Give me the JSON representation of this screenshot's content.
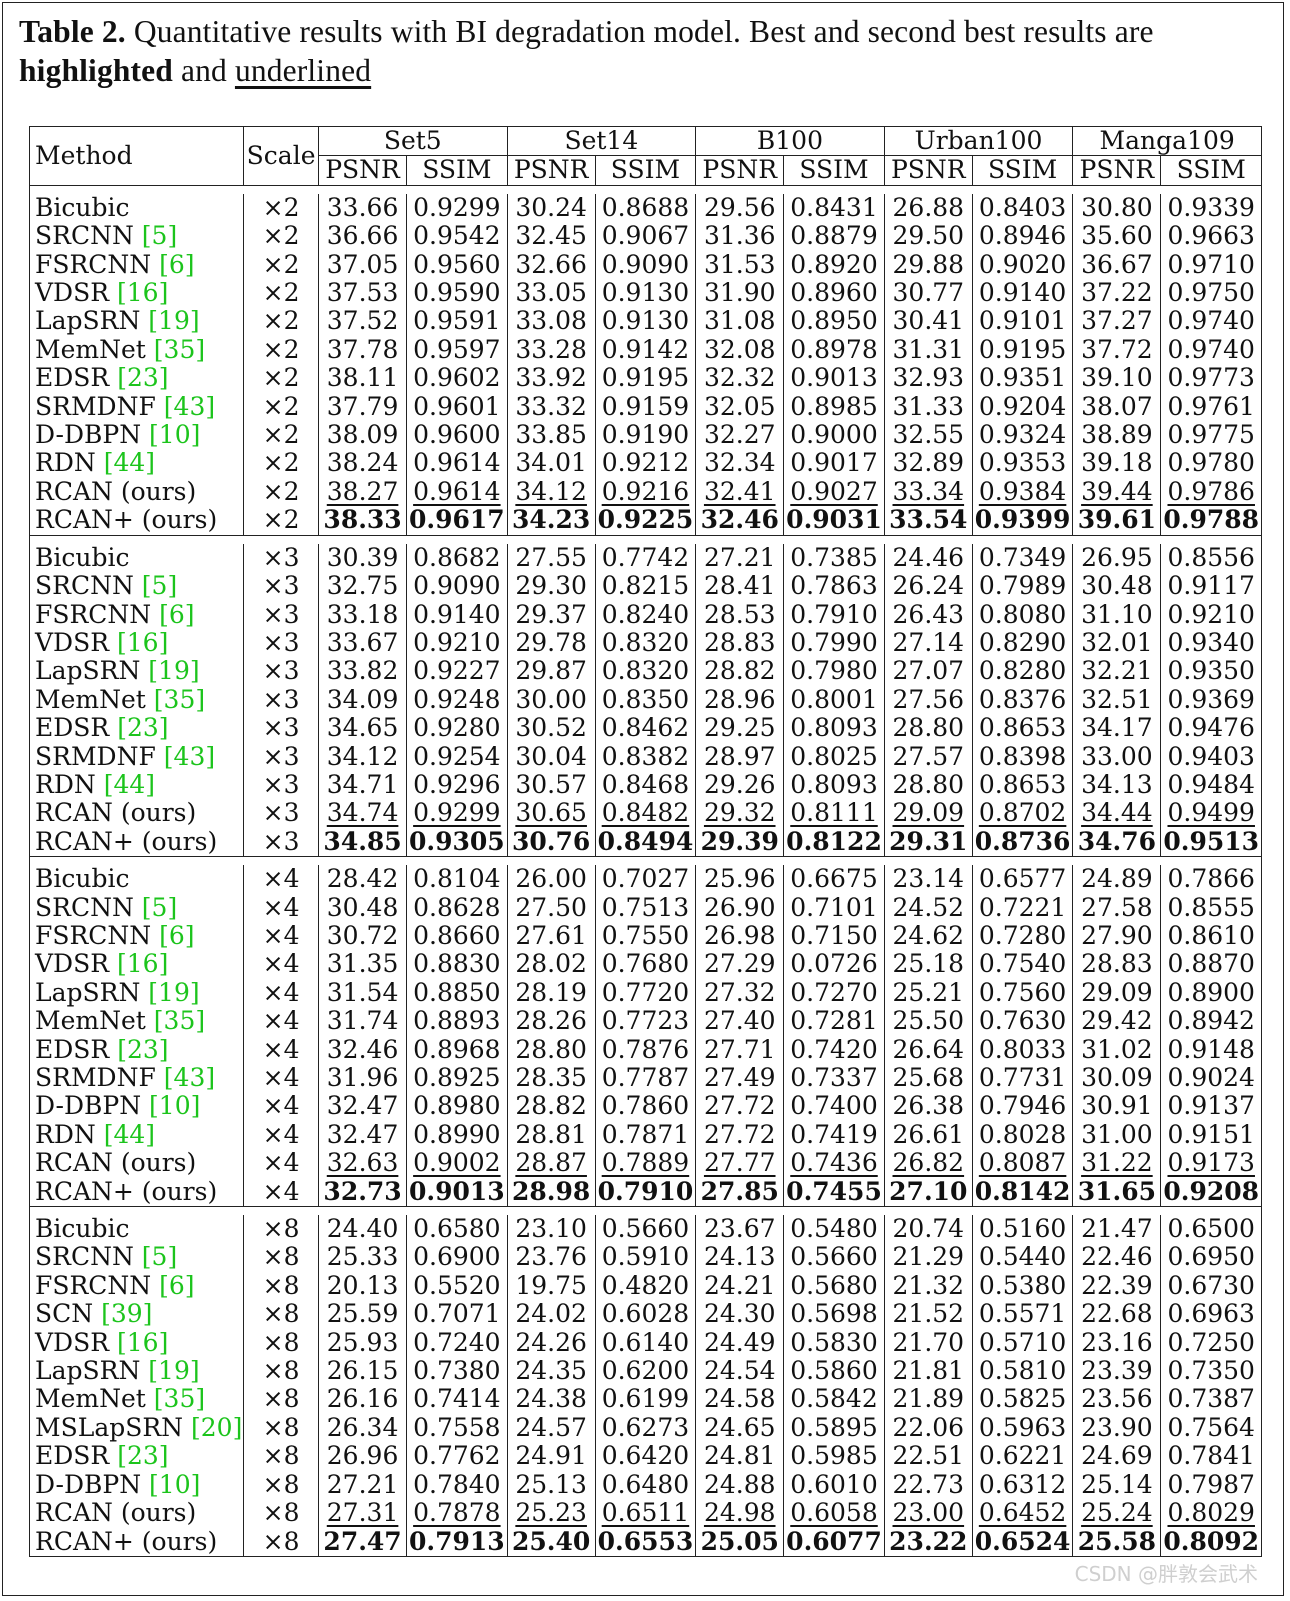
{
  "caption": {
    "label": "Table 2.",
    "text1": " Quantitative results with BI degradation model. Best and second best results are ",
    "highlighted": "highlighted",
    "text2": " and ",
    "underlined": "underlined"
  },
  "header": {
    "method": "Method",
    "scale": "Scale",
    "datasets": [
      "Set5",
      "Set14",
      "B100",
      "Urban100",
      "Manga109"
    ],
    "metrics": [
      "PSNR",
      "SSIM"
    ]
  },
  "groups": [
    {
      "rows": [
        {
          "method": "Bicubic",
          "cite": "",
          "scale": "×2",
          "values": [
            "33.66",
            "0.9299",
            "30.24",
            "0.8688",
            "29.56",
            "0.8431",
            "26.88",
            "0.8403",
            "30.80",
            "0.9339"
          ],
          "style": ""
        },
        {
          "method": "SRCNN",
          "cite": "[5]",
          "scale": "×2",
          "values": [
            "36.66",
            "0.9542",
            "32.45",
            "0.9067",
            "31.36",
            "0.8879",
            "29.50",
            "0.8946",
            "35.60",
            "0.9663"
          ],
          "style": ""
        },
        {
          "method": "FSRCNN",
          "cite": "[6]",
          "scale": "×2",
          "values": [
            "37.05",
            "0.9560",
            "32.66",
            "0.9090",
            "31.53",
            "0.8920",
            "29.88",
            "0.9020",
            "36.67",
            "0.9710"
          ],
          "style": ""
        },
        {
          "method": "VDSR",
          "cite": "[16]",
          "scale": "×2",
          "values": [
            "37.53",
            "0.9590",
            "33.05",
            "0.9130",
            "31.90",
            "0.8960",
            "30.77",
            "0.9140",
            "37.22",
            "0.9750"
          ],
          "style": ""
        },
        {
          "method": "LapSRN",
          "cite": "[19]",
          "scale": "×2",
          "values": [
            "37.52",
            "0.9591",
            "33.08",
            "0.9130",
            "31.08",
            "0.8950",
            "30.41",
            "0.9101",
            "37.27",
            "0.9740"
          ],
          "style": ""
        },
        {
          "method": "MemNet",
          "cite": "[35]",
          "scale": "×2",
          "values": [
            "37.78",
            "0.9597",
            "33.28",
            "0.9142",
            "32.08",
            "0.8978",
            "31.31",
            "0.9195",
            "37.72",
            "0.9740"
          ],
          "style": ""
        },
        {
          "method": "EDSR",
          "cite": "[23]",
          "scale": "×2",
          "values": [
            "38.11",
            "0.9602",
            "33.92",
            "0.9195",
            "32.32",
            "0.9013",
            "32.93",
            "0.9351",
            "39.10",
            "0.9773"
          ],
          "style": ""
        },
        {
          "method": "SRMDNF",
          "cite": "[43]",
          "scale": "×2",
          "values": [
            "37.79",
            "0.9601",
            "33.32",
            "0.9159",
            "32.05",
            "0.8985",
            "31.33",
            "0.9204",
            "38.07",
            "0.9761"
          ],
          "style": ""
        },
        {
          "method": "D-DBPN",
          "cite": "[10]",
          "scale": "×2",
          "values": [
            "38.09",
            "0.9600",
            "33.85",
            "0.9190",
            "32.27",
            "0.9000",
            "32.55",
            "0.9324",
            "38.89",
            "0.9775"
          ],
          "style": ""
        },
        {
          "method": "RDN",
          "cite": "[44]",
          "scale": "×2",
          "values": [
            "38.24",
            "0.9614",
            "34.01",
            "0.9212",
            "32.34",
            "0.9017",
            "32.89",
            "0.9353",
            "39.18",
            "0.9780"
          ],
          "style": ""
        },
        {
          "method": "RCAN (ours)",
          "cite": "",
          "scale": "×2",
          "values": [
            "38.27",
            "0.9614",
            "34.12",
            "0.9216",
            "32.41",
            "0.9027",
            "33.34",
            "0.9384",
            "39.44",
            "0.9786"
          ],
          "style": "u"
        },
        {
          "method": "RCAN+ (ours)",
          "cite": "",
          "scale": "×2",
          "values": [
            "38.33",
            "0.9617",
            "34.23",
            "0.9225",
            "32.46",
            "0.9031",
            "33.54",
            "0.9399",
            "39.61",
            "0.9788"
          ],
          "style": "b"
        }
      ]
    },
    {
      "rows": [
        {
          "method": "Bicubic",
          "cite": "",
          "scale": "×3",
          "values": [
            "30.39",
            "0.8682",
            "27.55",
            "0.7742",
            "27.21",
            "0.7385",
            "24.46",
            "0.7349",
            "26.95",
            "0.8556"
          ],
          "style": ""
        },
        {
          "method": "SRCNN",
          "cite": "[5]",
          "scale": "×3",
          "values": [
            "32.75",
            "0.9090",
            "29.30",
            "0.8215",
            "28.41",
            "0.7863",
            "26.24",
            "0.7989",
            "30.48",
            "0.9117"
          ],
          "style": ""
        },
        {
          "method": "FSRCNN",
          "cite": "[6]",
          "scale": "×3",
          "values": [
            "33.18",
            "0.9140",
            "29.37",
            "0.8240",
            "28.53",
            "0.7910",
            "26.43",
            "0.8080",
            "31.10",
            "0.9210"
          ],
          "style": ""
        },
        {
          "method": "VDSR",
          "cite": "[16]",
          "scale": "×3",
          "values": [
            "33.67",
            "0.9210",
            "29.78",
            "0.8320",
            "28.83",
            "0.7990",
            "27.14",
            "0.8290",
            "32.01",
            "0.9340"
          ],
          "style": ""
        },
        {
          "method": "LapSRN",
          "cite": "[19]",
          "scale": "×3",
          "values": [
            "33.82",
            "0.9227",
            "29.87",
            "0.8320",
            "28.82",
            "0.7980",
            "27.07",
            "0.8280",
            "32.21",
            "0.9350"
          ],
          "style": ""
        },
        {
          "method": "MemNet",
          "cite": "[35]",
          "scale": "×3",
          "values": [
            "34.09",
            "0.9248",
            "30.00",
            "0.8350",
            "28.96",
            "0.8001",
            "27.56",
            "0.8376",
            "32.51",
            "0.9369"
          ],
          "style": ""
        },
        {
          "method": "EDSR",
          "cite": "[23]",
          "scale": "×3",
          "values": [
            "34.65",
            "0.9280",
            "30.52",
            "0.8462",
            "29.25",
            "0.8093",
            "28.80",
            "0.8653",
            "34.17",
            "0.9476"
          ],
          "style": ""
        },
        {
          "method": "SRMDNF",
          "cite": "[43]",
          "scale": "×3",
          "values": [
            "34.12",
            "0.9254",
            "30.04",
            "0.8382",
            "28.97",
            "0.8025",
            "27.57",
            "0.8398",
            "33.00",
            "0.9403"
          ],
          "style": ""
        },
        {
          "method": "RDN",
          "cite": "[44]",
          "scale": "×3",
          "values": [
            "34.71",
            "0.9296",
            "30.57",
            "0.8468",
            "29.26",
            "0.8093",
            "28.80",
            "0.8653",
            "34.13",
            "0.9484"
          ],
          "style": ""
        },
        {
          "method": "RCAN (ours)",
          "cite": "",
          "scale": "×3",
          "values": [
            "34.74",
            "0.9299",
            "30.65",
            "0.8482",
            "29.32",
            "0.8111",
            "29.09",
            "0.8702",
            "34.44",
            "0.9499"
          ],
          "style": "u"
        },
        {
          "method": "RCAN+ (ours)",
          "cite": "",
          "scale": "×3",
          "values": [
            "34.85",
            "0.9305",
            "30.76",
            "0.8494",
            "29.39",
            "0.8122",
            "29.31",
            "0.8736",
            "34.76",
            "0.9513"
          ],
          "style": "b"
        }
      ]
    },
    {
      "rows": [
        {
          "method": "Bicubic",
          "cite": "",
          "scale": "×4",
          "values": [
            "28.42",
            "0.8104",
            "26.00",
            "0.7027",
            "25.96",
            "0.6675",
            "23.14",
            "0.6577",
            "24.89",
            "0.7866"
          ],
          "style": ""
        },
        {
          "method": "SRCNN",
          "cite": "[5]",
          "scale": "×4",
          "values": [
            "30.48",
            "0.8628",
            "27.50",
            "0.7513",
            "26.90",
            "0.7101",
            "24.52",
            "0.7221",
            "27.58",
            "0.8555"
          ],
          "style": ""
        },
        {
          "method": "FSRCNN",
          "cite": "[6]",
          "scale": "×4",
          "values": [
            "30.72",
            "0.8660",
            "27.61",
            "0.7550",
            "26.98",
            "0.7150",
            "24.62",
            "0.7280",
            "27.90",
            "0.8610"
          ],
          "style": ""
        },
        {
          "method": "VDSR",
          "cite": "[16]",
          "scale": "×4",
          "values": [
            "31.35",
            "0.8830",
            "28.02",
            "0.7680",
            "27.29",
            "0.0726",
            "25.18",
            "0.7540",
            "28.83",
            "0.8870"
          ],
          "style": ""
        },
        {
          "method": "LapSRN",
          "cite": "[19]",
          "scale": "×4",
          "values": [
            "31.54",
            "0.8850",
            "28.19",
            "0.7720",
            "27.32",
            "0.7270",
            "25.21",
            "0.7560",
            "29.09",
            "0.8900"
          ],
          "style": ""
        },
        {
          "method": "MemNet",
          "cite": "[35]",
          "scale": "×4",
          "values": [
            "31.74",
            "0.8893",
            "28.26",
            "0.7723",
            "27.40",
            "0.7281",
            "25.50",
            "0.7630",
            "29.42",
            "0.8942"
          ],
          "style": ""
        },
        {
          "method": "EDSR",
          "cite": "[23]",
          "scale": "×4",
          "values": [
            "32.46",
            "0.8968",
            "28.80",
            "0.7876",
            "27.71",
            "0.7420",
            "26.64",
            "0.8033",
            "31.02",
            "0.9148"
          ],
          "style": ""
        },
        {
          "method": "SRMDNF",
          "cite": "[43]",
          "scale": "×4",
          "values": [
            "31.96",
            "0.8925",
            "28.35",
            "0.7787",
            "27.49",
            "0.7337",
            "25.68",
            "0.7731",
            "30.09",
            "0.9024"
          ],
          "style": ""
        },
        {
          "method": "D-DBPN",
          "cite": "[10]",
          "scale": "×4",
          "values": [
            "32.47",
            "0.8980",
            "28.82",
            "0.7860",
            "27.72",
            "0.7400",
            "26.38",
            "0.7946",
            "30.91",
            "0.9137"
          ],
          "style": ""
        },
        {
          "method": "RDN",
          "cite": "[44]",
          "scale": "×4",
          "values": [
            "32.47",
            "0.8990",
            "28.81",
            "0.7871",
            "27.72",
            "0.7419",
            "26.61",
            "0.8028",
            "31.00",
            "0.9151"
          ],
          "style": ""
        },
        {
          "method": "RCAN (ours)",
          "cite": "",
          "scale": "×4",
          "values": [
            "32.63",
            "0.9002",
            "28.87",
            "0.7889",
            "27.77",
            "0.7436",
            "26.82",
            "0.8087",
            "31.22",
            "0.9173"
          ],
          "style": "u"
        },
        {
          "method": "RCAN+ (ours)",
          "cite": "",
          "scale": "×4",
          "values": [
            "32.73",
            "0.9013",
            "28.98",
            "0.7910",
            "27.85",
            "0.7455",
            "27.10",
            "0.8142",
            "31.65",
            "0.9208"
          ],
          "style": "b"
        }
      ]
    },
    {
      "rows": [
        {
          "method": "Bicubic",
          "cite": "",
          "scale": "×8",
          "values": [
            "24.40",
            "0.6580",
            "23.10",
            "0.5660",
            "23.67",
            "0.5480",
            "20.74",
            "0.5160",
            "21.47",
            "0.6500"
          ],
          "style": ""
        },
        {
          "method": "SRCNN",
          "cite": "[5]",
          "scale": "×8",
          "values": [
            "25.33",
            "0.6900",
            "23.76",
            "0.5910",
            "24.13",
            "0.5660",
            "21.29",
            "0.5440",
            "22.46",
            "0.6950"
          ],
          "style": ""
        },
        {
          "method": "FSRCNN",
          "cite": "[6]",
          "scale": "×8",
          "values": [
            "20.13",
            "0.5520",
            "19.75",
            "0.4820",
            "24.21",
            "0.5680",
            "21.32",
            "0.5380",
            "22.39",
            "0.6730"
          ],
          "style": ""
        },
        {
          "method": "SCN",
          "cite": "[39]",
          "scale": "×8",
          "values": [
            "25.59",
            "0.7071",
            "24.02",
            "0.6028",
            "24.30",
            "0.5698",
            "21.52",
            "0.5571",
            "22.68",
            "0.6963"
          ],
          "style": ""
        },
        {
          "method": "VDSR",
          "cite": "[16]",
          "scale": "×8",
          "values": [
            "25.93",
            "0.7240",
            "24.26",
            "0.6140",
            "24.49",
            "0.5830",
            "21.70",
            "0.5710",
            "23.16",
            "0.7250"
          ],
          "style": ""
        },
        {
          "method": "LapSRN",
          "cite": "[19]",
          "scale": "×8",
          "values": [
            "26.15",
            "0.7380",
            "24.35",
            "0.6200",
            "24.54",
            "0.5860",
            "21.81",
            "0.5810",
            "23.39",
            "0.7350"
          ],
          "style": ""
        },
        {
          "method": "MemNet",
          "cite": "[35]",
          "scale": "×8",
          "values": [
            "26.16",
            "0.7414",
            "24.38",
            "0.6199",
            "24.58",
            "0.5842",
            "21.89",
            "0.5825",
            "23.56",
            "0.7387"
          ],
          "style": ""
        },
        {
          "method": "MSLapSRN",
          "cite": "[20]",
          "scale": "×8",
          "values": [
            "26.34",
            "0.7558",
            "24.57",
            "0.6273",
            "24.65",
            "0.5895",
            "22.06",
            "0.5963",
            "23.90",
            "0.7564"
          ],
          "style": ""
        },
        {
          "method": "EDSR",
          "cite": "[23]",
          "scale": "×8",
          "values": [
            "26.96",
            "0.7762",
            "24.91",
            "0.6420",
            "24.81",
            "0.5985",
            "22.51",
            "0.6221",
            "24.69",
            "0.7841"
          ],
          "style": ""
        },
        {
          "method": "D-DBPN",
          "cite": "[10]",
          "scale": "×8",
          "values": [
            "27.21",
            "0.7840",
            "25.13",
            "0.6480",
            "24.88",
            "0.6010",
            "22.73",
            "0.6312",
            "25.14",
            "0.7987"
          ],
          "style": ""
        },
        {
          "method": "RCAN (ours)",
          "cite": "",
          "scale": "×8",
          "values": [
            "27.31",
            "0.7878",
            "25.23",
            "0.6511",
            "24.98",
            "0.6058",
            "23.00",
            "0.6452",
            "25.24",
            "0.8029"
          ],
          "style": "u"
        },
        {
          "method": "RCAN+ (ours)",
          "cite": "",
          "scale": "×8",
          "values": [
            "27.47",
            "0.7913",
            "25.40",
            "0.6553",
            "25.05",
            "0.6077",
            "23.22",
            "0.6524",
            "25.58",
            "0.8092"
          ],
          "style": "b"
        }
      ]
    }
  ],
  "watermark": "CSDN @胖敦会武术"
}
